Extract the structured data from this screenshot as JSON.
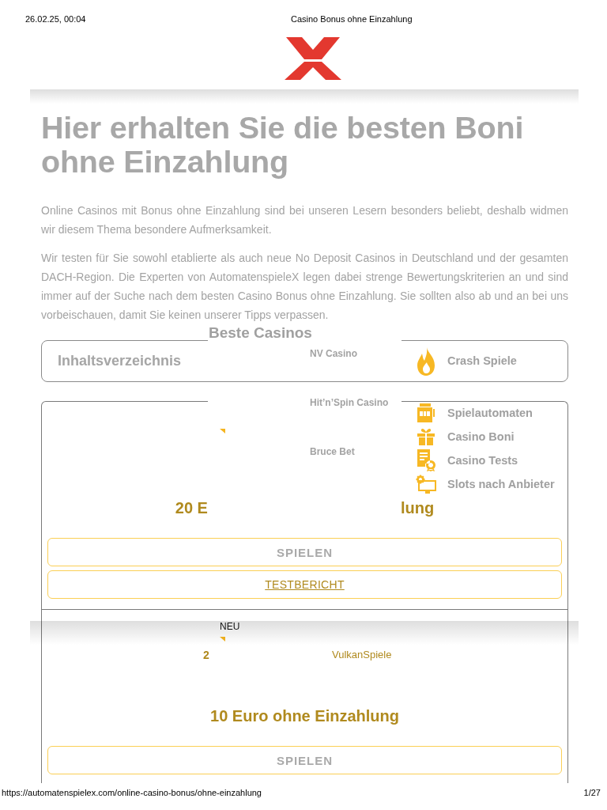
{
  "print_header": {
    "date": "26.02.25, 00:04",
    "title": "Casino Bonus ohne Einzahlung"
  },
  "article": {
    "heading": "Hier erhalten Sie die besten Boni ohne Einzahlung",
    "paragraphs": [
      "Online Casinos mit Bonus ohne Einzahlung sind bei unseren Lesern besonders beliebt, deshalb widmen wir diesem Thema besondere Aufmerksamkeit.",
      "Wir testen für Sie sowohl etablierte als auch neue No Deposit Casinos in Deutschland und der gesamten DACH-Region. Die Experten von AutomatenspieleX legen dabei strenge Bewertungskriterien an und sind immer auf der Suche nach dem besten Casino Bonus ohne Einzahlung. Sie sollten also ab und an bei uns vorbeischauen, damit Sie keinen unserer Tipps verpassen."
    ]
  },
  "toc": {
    "title": "Inhaltsverzeichnis"
  },
  "casino_cards": [
    {
      "title_parts": [
        "20 E",
        "lung"
      ],
      "buttons": [
        {
          "kind": "play",
          "label": "SPIELEN"
        },
        {
          "kind": "review",
          "label": "TESTBERICHT"
        }
      ]
    },
    {
      "badge": "NEU",
      "rank": "2",
      "name": "VulkanSpiele",
      "title_parts": [
        "10 Euro ohne Einzahlung"
      ],
      "buttons": [
        {
          "kind": "play",
          "label": "SPIELEN"
        }
      ]
    }
  ],
  "nav_menu": {
    "links": [
      "Crash Spiele",
      "Spielautomaten",
      "Casino Boni",
      "Casino Tests",
      "Slots nach Anbieter"
    ],
    "section_title": "Beste Casinos",
    "casinos": [
      "NV Casino",
      "Hit’n’Spin Casino",
      "Bruce Bet"
    ]
  },
  "print_footer": {
    "url": "https://automatenspielex.com/online-casino-bonus/ohne-einzahlung",
    "page": "1/27"
  }
}
